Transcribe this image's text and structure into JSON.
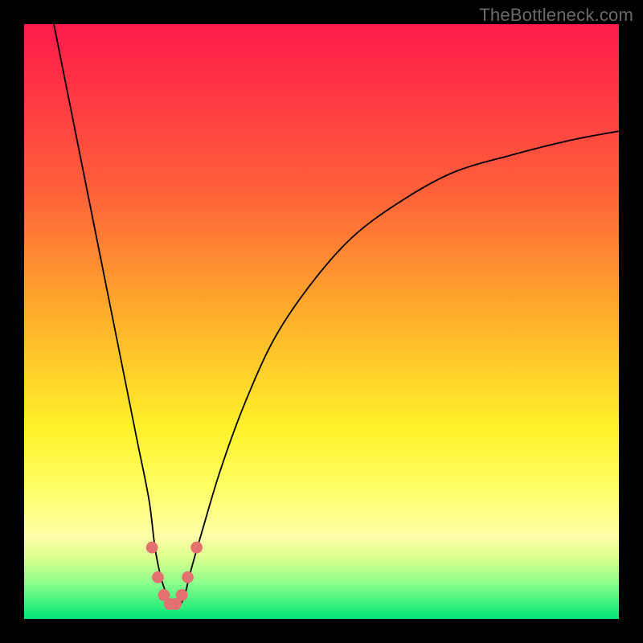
{
  "watermark": "TheBottleneck.com",
  "chart_data": {
    "type": "line",
    "title": "",
    "xlabel": "",
    "ylabel": "",
    "xlim": [
      0,
      100
    ],
    "ylim": [
      0,
      100
    ],
    "grid": false,
    "background_gradient": {
      "orientation": "vertical",
      "stops": [
        {
          "offset": 0.0,
          "color": "#ff1a4b"
        },
        {
          "offset": 0.28,
          "color": "#ff603a"
        },
        {
          "offset": 0.5,
          "color": "#ffb22a"
        },
        {
          "offset": 0.68,
          "color": "#fff22a"
        },
        {
          "offset": 0.78,
          "color": "#ffff66"
        },
        {
          "offset": 0.86,
          "color": "#ffffa8"
        },
        {
          "offset": 0.9,
          "color": "#d8ff8e"
        },
        {
          "offset": 0.94,
          "color": "#8cff8c"
        },
        {
          "offset": 1.0,
          "color": "#00e676"
        }
      ]
    },
    "series": [
      {
        "name": "bottleneck-curve",
        "color": "#000000",
        "x": [
          5,
          7,
          9,
          11,
          13,
          15,
          17,
          19,
          21,
          22,
          23,
          24,
          25,
          26,
          27,
          28,
          30,
          33,
          37,
          42,
          48,
          55,
          63,
          72,
          82,
          92,
          100
        ],
        "y": [
          100,
          90,
          80,
          70,
          60,
          50,
          40,
          30,
          20,
          12,
          7,
          4,
          2,
          2,
          4,
          8,
          15,
          25,
          36,
          47,
          56,
          64,
          70,
          75,
          78,
          80.5,
          82
        ]
      }
    ],
    "markers": {
      "name": "bottleneck-valley-points",
      "color": "#e4716f",
      "radius_pct": 1.0,
      "points": [
        {
          "x": 21.5,
          "y": 12
        },
        {
          "x": 22.5,
          "y": 7
        },
        {
          "x": 23.5,
          "y": 4
        },
        {
          "x": 24.5,
          "y": 2.5
        },
        {
          "x": 25.5,
          "y": 2.5
        },
        {
          "x": 26.5,
          "y": 4
        },
        {
          "x": 27.5,
          "y": 7
        },
        {
          "x": 29.0,
          "y": 12
        }
      ]
    }
  }
}
